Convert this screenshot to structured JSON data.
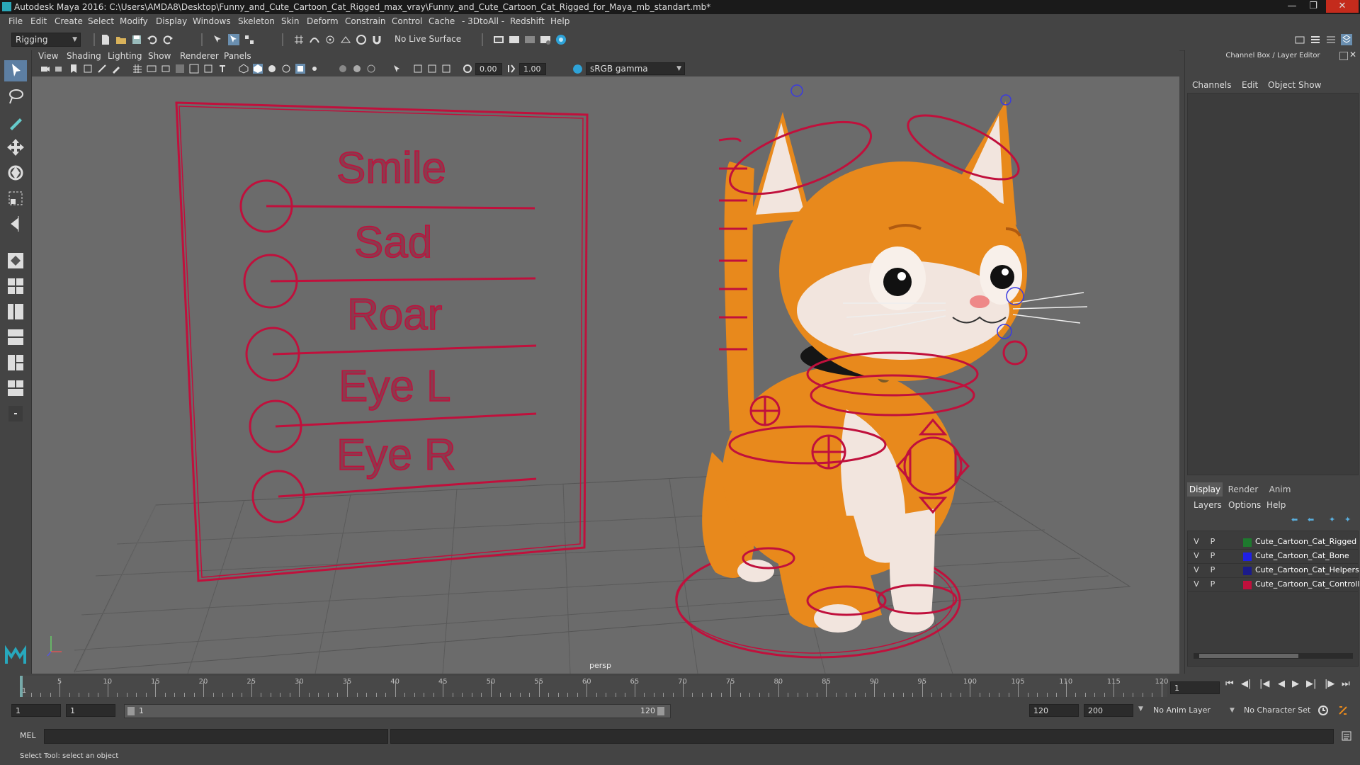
{
  "window": {
    "title": "Autodesk Maya 2016: C:\\Users\\AMDA8\\Desktop\\Funny_and_Cute_Cartoon_Cat_Rigged_max_vray\\Funny_and_Cute_Cartoon_Cat_Rigged_for_Maya_mb_standart.mb*"
  },
  "menubar": {
    "items": [
      "File",
      "Edit",
      "Create",
      "Select",
      "Modify",
      "Display",
      "Windows",
      "Skeleton",
      "Skin",
      "Deform",
      "Constrain",
      "Control",
      "Cache",
      "- 3DtoAll -",
      "Redshift",
      "Help"
    ]
  },
  "toolbar": {
    "mode": "Rigging",
    "live_surface": "No Live Surface"
  },
  "viewport": {
    "menu": [
      "View",
      "Shading",
      "Lighting",
      "Show",
      "Renderer",
      "Panels"
    ],
    "field_a": "0.00",
    "field_b": "1.00",
    "color_space": "sRGB gamma",
    "camera_label": "persp",
    "face_board_labels": [
      "Smile",
      "Sad",
      "Roar",
      "Eye L",
      "Eye R"
    ]
  },
  "channel_box": {
    "header": "Channel Box / Layer Editor",
    "menu": [
      "Channels",
      "Edit",
      "Object",
      "Show"
    ]
  },
  "layer_editor": {
    "tabs": [
      "Display",
      "Render",
      "Anim"
    ],
    "menu": [
      "Layers",
      "Options",
      "Help"
    ],
    "layers": [
      {
        "v": "V",
        "p": "P",
        "name": "Cute_Cartoon_Cat_Rigged",
        "color": "#1e7a2e"
      },
      {
        "v": "V",
        "p": "P",
        "name": "Cute_Cartoon_Cat_Bone",
        "color": "#1f1fe6"
      },
      {
        "v": "V",
        "p": "P",
        "name": "Cute_Cartoon_Cat_Helpers",
        "color": "#1b1b8a"
      },
      {
        "v": "V",
        "p": "P",
        "name": "Cute_Cartoon_Cat_Controlle",
        "color": "#c0103c"
      }
    ]
  },
  "timeline": {
    "ticks": [
      "1",
      "5",
      "10",
      "15",
      "20",
      "25",
      "30",
      "35",
      "40",
      "45",
      "50",
      "55",
      "60",
      "65",
      "70",
      "75",
      "80",
      "85",
      "90",
      "95",
      "100",
      "105",
      "110",
      "115",
      "120"
    ],
    "current_frame": "1"
  },
  "range": {
    "start": "1",
    "playback_start": "1",
    "slider_start": "1",
    "slider_end": "120",
    "playback_end": "120",
    "end": "200",
    "anim_layer": "No Anim Layer",
    "char_set": "No Character Set"
  },
  "command": {
    "lang": "MEL"
  },
  "help": {
    "text": "Select Tool: select an object"
  },
  "colors": {
    "control_red": "#c0103c",
    "cat_orange": "#e8891c"
  }
}
